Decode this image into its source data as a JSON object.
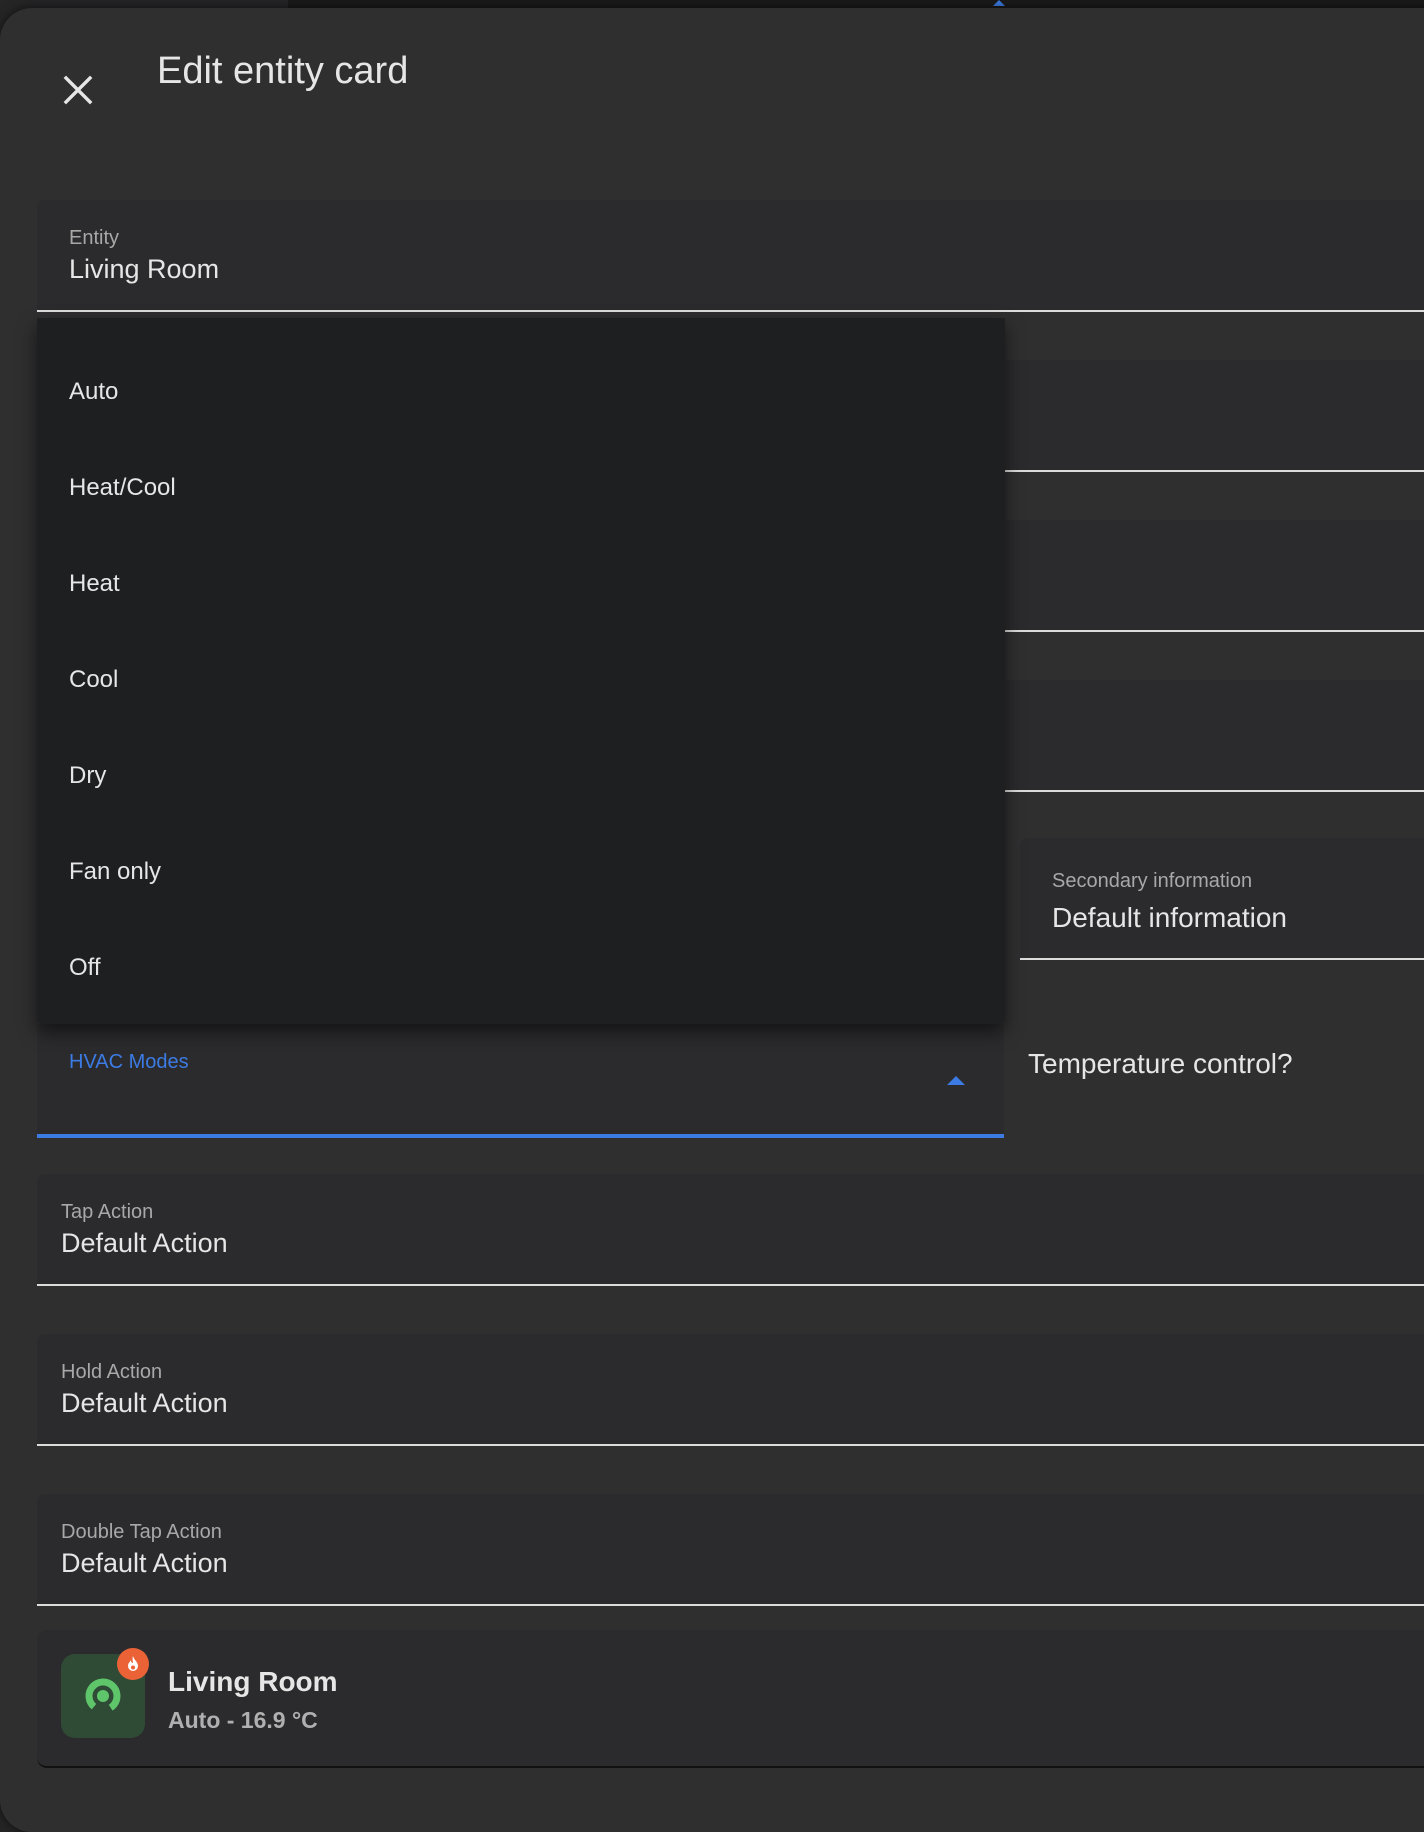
{
  "dialog": {
    "title": "Edit entity card"
  },
  "entity_field": {
    "label": "Entity",
    "value": "Living Room"
  },
  "hvac_menu": {
    "options": [
      "Auto",
      "Heat/Cool",
      "Heat",
      "Cool",
      "Dry",
      "Fan only",
      "Off"
    ]
  },
  "hvac_field": {
    "label": "HVAC Modes",
    "accent_color": "#3b7be3"
  },
  "secondary_info": {
    "label": "Secondary information",
    "value": "Default information"
  },
  "temperature_control": {
    "label": "Temperature control?"
  },
  "actions": {
    "tap": {
      "label": "Tap Action",
      "value": "Default Action"
    },
    "hold": {
      "label": "Hold Action",
      "value": "Default Action"
    },
    "double_tap": {
      "label": "Double Tap Action",
      "value": "Default Action"
    }
  },
  "preview": {
    "name": "Living Room",
    "state": "Auto - 16.9 °C",
    "icon": "thermostat-icon",
    "badge_icon": "fire-icon",
    "icon_color": "#5fc56a",
    "badge_color": "#ea6236"
  }
}
